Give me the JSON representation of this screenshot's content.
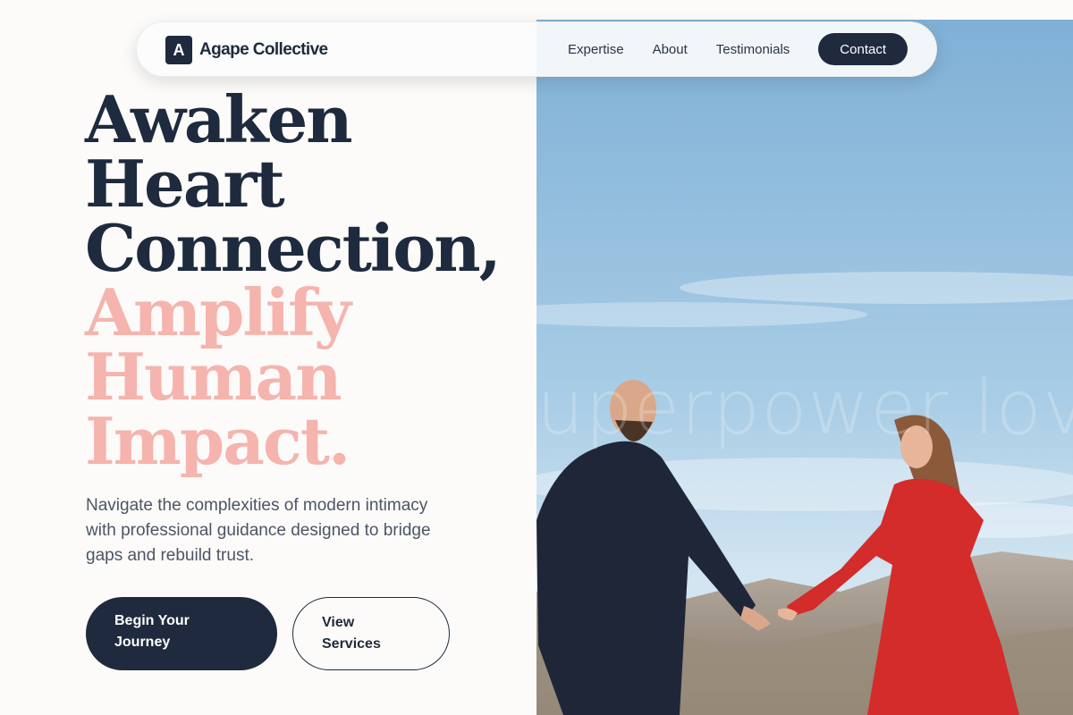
{
  "brand": {
    "mark": "A",
    "name": "Agape Collective"
  },
  "nav": {
    "links": [
      "Expertise",
      "About",
      "Testimonials"
    ],
    "contact": "Contact"
  },
  "hero": {
    "headline_dark": [
      "Awaken",
      "Heart",
      "Connection,"
    ],
    "headline_accent": [
      "Amplify",
      "Human",
      "Impact."
    ],
    "subtext": "Navigate the complexities of modern intimacy with professional guidance designed to bridge gaps and rebuild trust.",
    "primary_cta": [
      "Begin Your",
      "Journey"
    ],
    "secondary_cta": [
      "View",
      "Services"
    ],
    "image_watermark": "uperpower lov"
  },
  "colors": {
    "navy": "#1f2a3e",
    "accent_pink": "#f5b4ad",
    "background": "#fcfbf9"
  }
}
